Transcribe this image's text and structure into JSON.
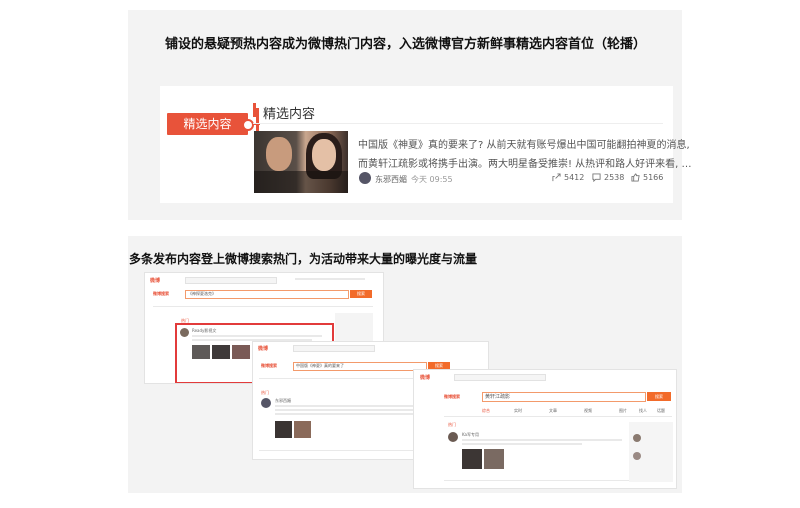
{
  "top": {
    "heading": "铺设的悬疑预热内容成为微博热门内容，入选微博官方新鲜事精选内容首位（轮播）",
    "tag_label": "精选内容",
    "section_title": "精选内容",
    "desc_line1": "中国版《神夏》真的要来了? 从前天就有账号爆出中国可能翻拍神夏的消息,",
    "desc_line2": "而黄轩江疏影或将携手出演。两大明星备受推崇! 从热评和路人好评来看, …",
    "author": "东邪西媚",
    "time": "今天 09:55",
    "stats": {
      "shares": "5412",
      "comments": "2538",
      "likes": "5166"
    },
    "icons": [
      "share-icon",
      "comment-icon",
      "like-icon"
    ]
  },
  "bottom": {
    "heading": "多条发布内容登上微博搜索热门，为活动带来大量的曝光度与流量",
    "shot1": {
      "logo": "微博",
      "search_label": "微博搜索",
      "query": "《神探夏洛克》",
      "button": "搜索",
      "hot": "热门",
      "user": "Ready影视文"
    },
    "shot2": {
      "logo": "微博",
      "search_label": "微博搜索",
      "query": "中国版《神夏》真的要来了",
      "button": "搜索",
      "hot": "热门",
      "user": "东邪西媚"
    },
    "shot3": {
      "logo": "微博",
      "search_label": "微博搜索",
      "query": "黄轩江疏影",
      "button": "搜索",
      "hot": "热门",
      "user": "Ka军专用",
      "tabs": [
        "综合",
        "实时",
        "文章",
        "视频",
        "图片",
        "找人",
        "话题"
      ]
    }
  },
  "colors": {
    "accent": "#e8533a",
    "panel": "#f3f3f3"
  }
}
